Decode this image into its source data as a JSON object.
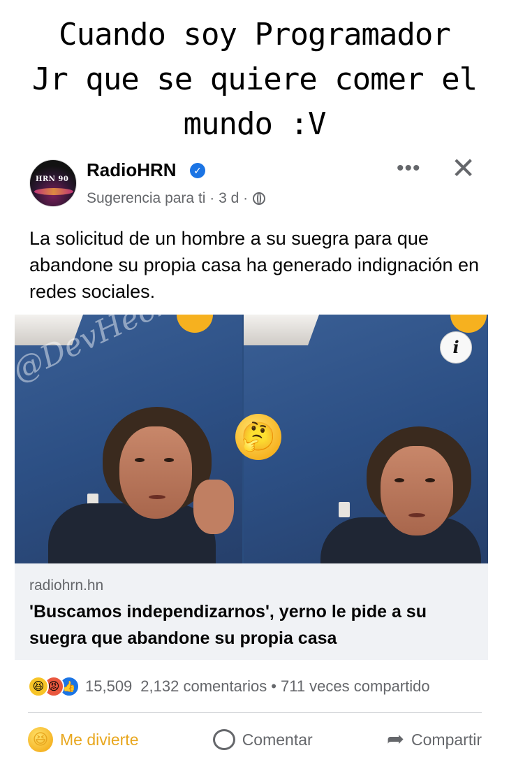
{
  "caption": "Cuando soy Programador\nJr que se quiere comer el\nmundo :V",
  "post": {
    "page_name": "RadioHRN",
    "avatar_text": "HRN 90",
    "meta_text": "Sugerencia para ti · 3 d ·",
    "body_text": "La solicitud de un hombre a su suegra para que abandone su propia casa ha generado indignación en redes sociales.",
    "watermark": "@DevHeckt",
    "info_label": "i"
  },
  "link": {
    "domain": "radiohrn.hn",
    "title": "'Buscamos independizarnos', yerno le pide a su suegra que abandone su propia casa"
  },
  "stats": {
    "reactions": "15,509",
    "comments": "2,132 comentarios",
    "separator": "•",
    "shares": "711 veces compartido"
  },
  "actions": {
    "react_label": "Me divierte",
    "comment_label": "Comentar",
    "share_label": "Compartir"
  },
  "colors": {
    "text": "#050505",
    "muted": "#65676b",
    "verified": "#1b74e4",
    "reaction_active": "#e8a71f",
    "link_bg": "#f0f2f5"
  }
}
